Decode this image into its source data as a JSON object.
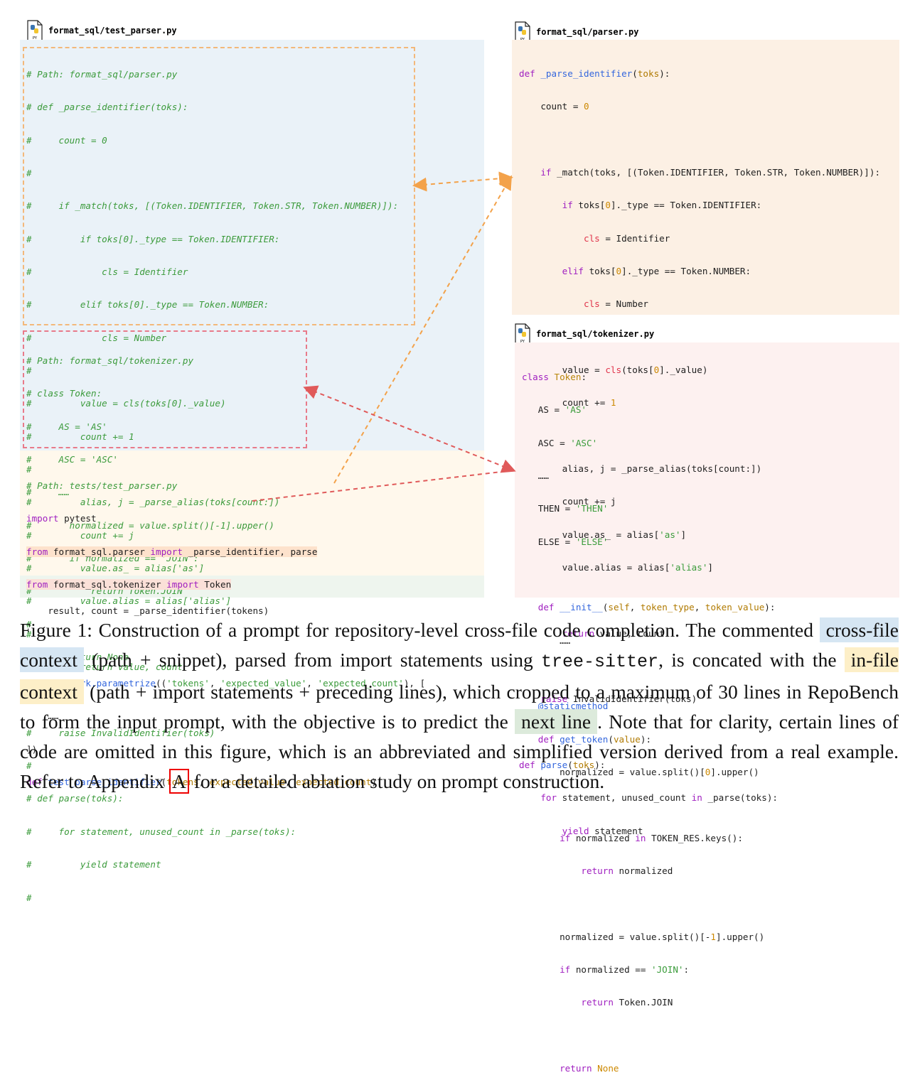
{
  "files": {
    "test_parser": "format_sql/test_parser.py",
    "parser": "format_sql/parser.py",
    "tokenizer": "format_sql/tokenizer.py"
  },
  "icons": {
    "file_icon": "python-file-icon",
    "file_icon_label": "PY"
  },
  "colors": {
    "cross_file_bg": "#eaf2f8",
    "in_file_bg": "#fff8ec",
    "next_line_bg": "#eef5ee",
    "parser_bg": "#fcf0e4",
    "tokenizer_bg": "#fdf1f0",
    "orange_arrow": "#f3a24a",
    "red_arrow": "#e05a5a",
    "comment_green": "#3c9b3c"
  },
  "left_panel": {
    "cross_file_parser": [
      "# Path: format_sql/parser.py",
      "# def _parse_identifier(toks):",
      "#     count = 0",
      "#",
      "#     if _match(toks, [(Token.IDENTIFIER, Token.STR, Token.NUMBER)]):",
      "#         if toks[0]._type == Token.IDENTIFIER:",
      "#             cls = Identifier",
      "#         elif toks[0]._type == Token.NUMBER:",
      "#             cls = Number",
      "#",
      "#         value = cls(toks[0]._value)",
      "#         count += 1",
      "#",
      "#         alias, j = _parse_alias(toks[count:])",
      "#         count += j",
      "#         value.as_ = alias['as']",
      "#         value.alias = alias['alias']",
      "#",
      "#         return value, count",
      "#",
      "#     raise InvalidIdentifier(toks)",
      "#",
      "# def parse(toks):",
      "#     for statement, unused_count in _parse(toks):",
      "#         yield statement",
      "#"
    ],
    "cross_file_tokenizer": [
      "# Path: format_sql/tokenizer.py",
      "# class Token:",
      "#     AS = 'AS'",
      "#     ASC = 'ASC'",
      "#     ……",
      "#       normalized = value.split()[-1].upper()",
      "#       if normalized == 'JOIN':",
      "#           return Token.JOIN",
      "#",
      "#       return None"
    ],
    "in_file": {
      "path_comment": "# Path: tests/test_parser.py",
      "import_pytest_kw": "import",
      "import_pytest_mod": " pytest",
      "from1_kw": "from",
      "from1_mod": " format_sql.parser ",
      "from1_imp": "import",
      "from1_names": " _parse_identifier, parse",
      "from2_kw": "from",
      "from2_mod": " format_sql.tokenizer ",
      "from2_imp": "import",
      "from2_names": " Token",
      "ellipsis1": "……",
      "decorator": "@pytest.mark.parametrize",
      "decorator_args_open": "((",
      "arg1": "'tokens'",
      "arg2": "'expected_value'",
      "arg3": "'expected_count'",
      "decorator_args_close": "), [",
      "ellipsis2": "……",
      "close_bracket": "])",
      "def_kw": "def",
      "def_name": " test_parse_identifier",
      "p1": "tokens",
      "p2": "expected_value",
      "p3": "expected_count",
      "def_end": "):"
    },
    "next_line": "    result, count = _parse_identifier(tokens)"
  },
  "parser_panel": {
    "def1_kw": "def",
    "def1_name": "_parse_identifier",
    "def1_param": "toks",
    "count_init": "count = ",
    "zero": "0",
    "if_match_kw": "if",
    "if_match_rest": " _match(toks, [(Token.IDENTIFIER, Token.STR, Token.NUMBER)]):",
    "if2_kw": "if",
    "if2_a": " toks[",
    "if2_b": "]._type == Token.IDENTIFIER:",
    "cls1": "cls",
    "cls1_rest": " = Identifier",
    "elif_kw": "elif",
    "elif_a": " toks[",
    "elif_b": "]._type == Token.NUMBER:",
    "cls2": "cls",
    "cls2_rest": " = Number",
    "value_a": "value = ",
    "value_cls": "cls",
    "value_b": "(toks[",
    "value_c": "]._value)",
    "count_inc": "count += ",
    "one": "1",
    "alias_line": "alias, j = _parse_alias(toks[count:])",
    "count_j": "count += j",
    "as_a": "value.as_ = alias[",
    "as_str": "'as'",
    "as_b": "]",
    "al_a": "value.alias = alias[",
    "al_str": "'alias'",
    "al_b": "]",
    "ret_kw": "return",
    "ret_rest": " value, count",
    "raise_kw": "raise",
    "raise_rest": " InvalidIdentifier(toks)",
    "def2_kw": "def",
    "def2_name": "parse",
    "def2_param": "toks",
    "for_kw": "for",
    "for_a": " statement, unused_count ",
    "in_kw": "in",
    "for_b": " _parse(toks):",
    "yield_kw": "yield",
    "yield_rest": " statement"
  },
  "tokenizer_panel": {
    "class_kw": "class",
    "class_name": "Token",
    "as_a": "AS = ",
    "as_v": "'AS'",
    "asc_a": "ASC = ",
    "asc_v": "'ASC'",
    "ellipsis1": "……",
    "then_a": "THEN = ",
    "then_v": "'THEN'",
    "else_a": "ELSE = ",
    "else_v": "'ELSE'",
    "init_kw": "def",
    "init_name": "__init__",
    "init_self": "self",
    "init_p1": "token_type",
    "init_p2": "token_value",
    "ellipsis2": "……",
    "decorator": "@staticmethod",
    "get_kw": "def",
    "get_name": "get_token",
    "get_param": "value",
    "norm1_a": "normalized = value.split()[",
    "norm1_n": "0",
    "norm1_b": "].upper()",
    "if1_kw": "if",
    "if1_a": " normalized ",
    "if1_in": "in",
    "if1_b": " TOKEN_RES.keys():",
    "ret1_kw": "return",
    "ret1_rest": " normalized",
    "norm2_a": "normalized = value.split()[-",
    "norm2_n": "1",
    "norm2_b": "].upper()",
    "if2_kw": "if",
    "if2_a": " normalized == ",
    "if2_v": "'JOIN'",
    "if2_b": ":",
    "ret2_kw": "return",
    "ret2_rest": " Token.JOIN",
    "ret3_kw": "return",
    "ret3_none": " None"
  },
  "caption": {
    "s1": "Figure 1: Construction of a prompt for repository-level cross-file code completion. The commented",
    "tag_cross": "cross-file context",
    "s2": " (path + snippet), parsed from import statements using ",
    "mono": "tree-sitter",
    "s3": ", is concated with the ",
    "tag_in": "in-file context",
    "s4": " (path + import statements + preceding lines), which cropped to a maximum of 30 lines in RepoBench to form the input prompt, with the objective is to predict the ",
    "tag_next": "next line",
    "s5": ". Note that for clarity, certain lines of code are omitted in this figure, which is an abbreviated and simplified version derived from a real example. Refer to Appendix ",
    "ref": "A",
    "s6": " for a detailed ablation study on prompt construction."
  }
}
